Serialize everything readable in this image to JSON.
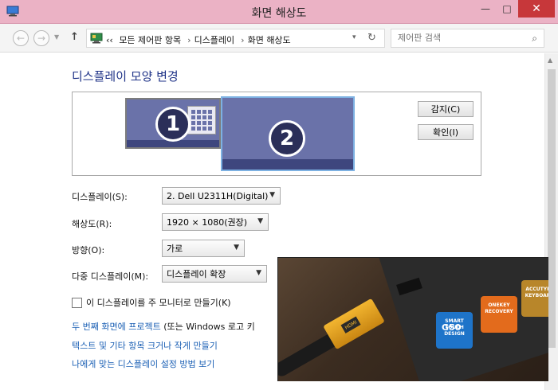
{
  "window": {
    "title": "화면 해상도",
    "controls": {
      "minimize": "—",
      "maximize": "□",
      "close": "✕"
    }
  },
  "nav": {
    "back_icon": "←",
    "forward_icon": "→",
    "dropdown_icon": "▼",
    "up_icon": "↑",
    "breadcrumb": {
      "prefix": "‹‹",
      "items": [
        "모든 제어판 항목",
        "디스플레이",
        "화면 해상도"
      ],
      "separator": "›"
    },
    "address_dropdown": "▾",
    "refresh_icon": "↻",
    "search_placeholder": "제어판 검색",
    "search_icon": "⌕"
  },
  "main": {
    "title": "디스플레이 모양 변경",
    "monitors": [
      {
        "number": "1",
        "selected": false
      },
      {
        "number": "2",
        "selected": true
      }
    ],
    "buttons": {
      "detect": "감지(C)",
      "identify": "확인(I)"
    },
    "fields": {
      "display_label": "디스플레이(S):",
      "display_value": "2. Dell U2311H(Digital)",
      "resolution_label": "해상도(R):",
      "resolution_value": "1920 × 1080(권장)",
      "orientation_label": "방향(O):",
      "orientation_value": "가로",
      "multi_label": "다중 디스플레이(M):",
      "multi_value": "디스플레이 확장"
    },
    "checkbox": {
      "label": "이 디스플레이를 주 모니터로 만들기(K)",
      "checked": false
    },
    "links": [
      {
        "text": "두 번째 화면에 프로젝트",
        "aux": "(또는 Windows 로고 키"
      },
      {
        "text": "텍스트 및 기타 항목 크거나 작게 만들기"
      },
      {
        "text": "나에게 맞는 디스플레이 설정 방법 보기"
      }
    ]
  },
  "photo": {
    "hdmi_label": "HDMI",
    "model": "G50",
    "stickers": [
      "SMART TOUCH DESIGN",
      "ONEKEY RECOVERY",
      "ACCUTYPE KEYBOARD"
    ]
  },
  "colors": {
    "titlebar": "#ebb2c5",
    "close_button": "#c7373a",
    "title_text": "#1e3287",
    "link": "#1a5fb4",
    "monitor": "#6a72a9",
    "monitor_selected_border": "#7db1e2"
  }
}
